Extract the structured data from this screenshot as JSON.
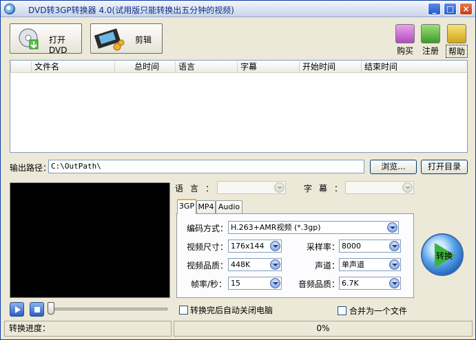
{
  "window": {
    "title": "DVD转3GP转换器 4.0(试用版只能转换出五分钟的视频)"
  },
  "toolbar": {
    "open_dvd_label": "打开DVD",
    "edit_label": "剪辑",
    "buy_label": "购买",
    "register_label": "注册",
    "help_label": "帮助"
  },
  "file_list": {
    "columns": [
      "文件名",
      "总时间",
      "语言",
      "字幕",
      "开始时间",
      "结束时间"
    ]
  },
  "output": {
    "label": "输出路径：",
    "path": "C:\\OutPath\\",
    "browse_label": "浏览...",
    "open_dir_label": "打开目录"
  },
  "track": {
    "language_label": "语言：",
    "subtitle_label": "字幕："
  },
  "tabs": [
    "3GP",
    "MP4",
    "Audio"
  ],
  "settings": {
    "codec_label": "编码方式：",
    "codec_value": "H.263+AMR视频 (*.3gp)",
    "size_label": "视频尺寸：",
    "size_value": "176x144",
    "quality_label": "视频品质：",
    "quality_value": "448K",
    "fps_label": "帧率/秒：",
    "fps_value": "15",
    "samplerate_label": "采样率：",
    "samplerate_value": "8000",
    "channel_label": "声道：",
    "channel_value": "单声道",
    "audio_quality_label": "音频品质：",
    "audio_quality_value": "6.7K"
  },
  "convert_label": "转换",
  "options": {
    "shutdown_label": "转换完后自动关闭电脑",
    "merge_label": "合并为一个文件"
  },
  "status": {
    "progress_label": "转换进度：",
    "progress_percent": "0%"
  }
}
